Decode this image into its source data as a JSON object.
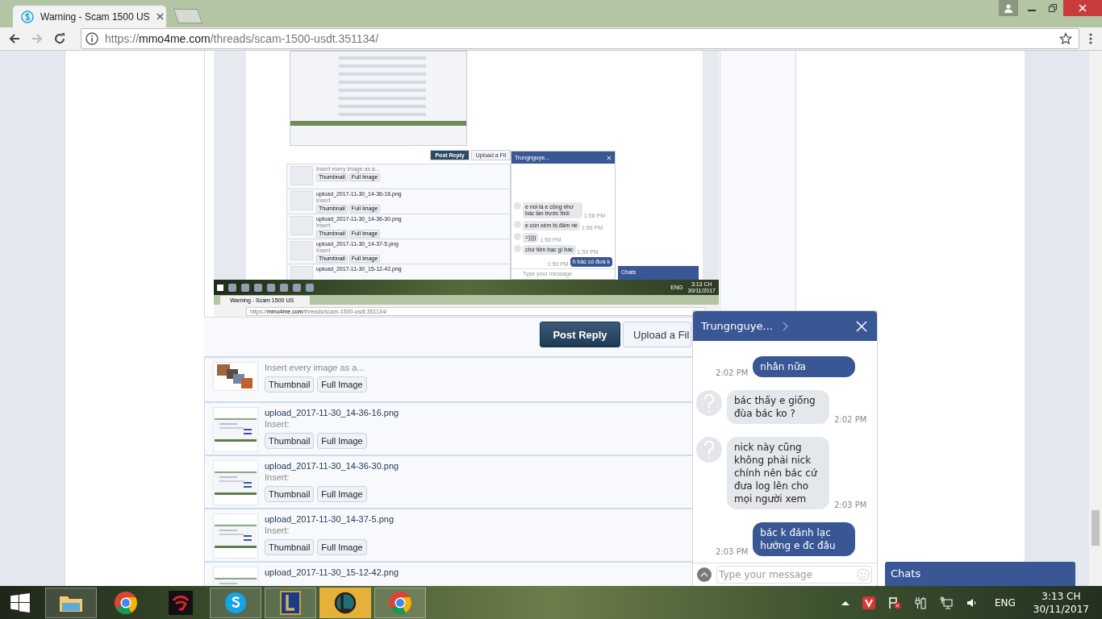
{
  "browser": {
    "tab_title": "Warning - Scam 1500 US",
    "url": {
      "scheme": "https://",
      "host": "mmo4me.com",
      "path": "/threads/scam-1500-usdt.351134/"
    }
  },
  "post_image": {
    "buttons": [
      {
        "kind": "primary",
        "label": "Post Reply"
      },
      {
        "kind": "secondary",
        "label": "Upload a Fil"
      }
    ],
    "bulk": {
      "text": "Insert every image as a...",
      "buttons": [
        "Thumbnail",
        "Full Image"
      ]
    },
    "files": [
      {
        "name": "upload_2017-11-30_14-36-16.png",
        "insert_label": "Insert",
        "buttons": [
          "Thumbnail",
          "Full Image"
        ]
      },
      {
        "name": "upload_2017-11-30_14-36-30.png",
        "insert_label": "Insert",
        "buttons": [
          "Thumbnail",
          "Full Image"
        ]
      },
      {
        "name": "upload_2017-11-30_14-37-5.png",
        "insert_label": "Insert",
        "buttons": [
          "Thumbnail",
          "Full Image"
        ]
      },
      {
        "name": "upload_2017-11-30_15-12-42.png"
      }
    ],
    "chat": {
      "title": "Trungnguye...",
      "placeholder": "Type your message",
      "messages": [
        {
          "kind": "received",
          "text": "e nói là e cũng như bác lần trước thôi",
          "time": "1:58 PM"
        },
        {
          "kind": "received",
          "text": "e còn xém bị đấm nè",
          "time": "1:58 PM"
        },
        {
          "kind": "received",
          "text": "=))))",
          "time": "1:58 PM"
        },
        {
          "kind": "received",
          "text": "chứ tiền bạc gì bác",
          "time": "1:59 PM"
        },
        {
          "kind": "sent",
          "text": "h bác có đưa k",
          "time": "1:59 PM"
        }
      ]
    },
    "chats_bar": "Chats",
    "taskbar": {
      "language": "ENG",
      "time": "3:13 CH",
      "date": "30/11/2017"
    },
    "tab_title": "Warning - Scam 1500 US",
    "url": {
      "scheme": "https://",
      "host": "mmo4me.com",
      "path": "/threads/scam-1500-usdt.351134/"
    }
  },
  "buttons": [
    {
      "kind": "primary",
      "label": "Post Reply"
    },
    {
      "kind": "secondary",
      "label": "Upload a Fil"
    }
  ],
  "bulk": {
    "text": "Insert every image as a...",
    "buttons": [
      "Thumbnail",
      "Full Image"
    ]
  },
  "files": [
    {
      "name": "upload_2017-11-30_14-36-16.png",
      "insert_label": "Insert:",
      "buttons": [
        "Thumbnail",
        "Full Image"
      ]
    },
    {
      "name": "upload_2017-11-30_14-36-30.png",
      "insert_label": "Insert:",
      "buttons": [
        "Thumbnail",
        "Full Image"
      ]
    },
    {
      "name": "upload_2017-11-30_14-37-5.png",
      "insert_label": "Insert:",
      "buttons": [
        "Thumbnail",
        "Full Image"
      ]
    },
    {
      "name": "upload_2017-11-30_15-12-42.png"
    }
  ],
  "chat": {
    "title": "Trungnguye...",
    "placeholder": "Type your message",
    "messages": [
      {
        "kind": "sent",
        "text": "nhân nữa",
        "time": "2:02 PM"
      },
      {
        "kind": "received",
        "text": "bác thấy e giống đùa bác ko ?",
        "time": "2:02 PM"
      },
      {
        "kind": "received",
        "text": "nick này cũng không phải nick chính nên bác cứ đưa log lên cho mọi người xem",
        "time": "2:03 PM"
      },
      {
        "kind": "sent",
        "text": "bác k đánh lạc hướng e đc đâu",
        "time": "2:03 PM"
      }
    ]
  },
  "chats_bar": "Chats",
  "taskbar": {
    "language": "ENG",
    "time": "3:13 CH",
    "date": "30/11/2017"
  }
}
